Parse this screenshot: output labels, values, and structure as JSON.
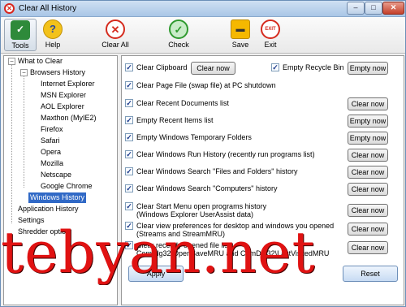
{
  "window": {
    "title": "Clear All History",
    "controls": {
      "minimize": "–",
      "maximize": "□",
      "close": "✕"
    }
  },
  "toolbar": {
    "tools_label": "Tools",
    "help_label": "Help",
    "clear_all_label": "Clear All",
    "check_label": "Check",
    "save_label": "Save",
    "exit_label": "Exit",
    "exit_icon_text": "EXIT"
  },
  "tree": {
    "what_to_clear": "What to Clear",
    "browsers_history": "Browsers History",
    "browsers": [
      "Internet Explorer",
      "MSN Explorer",
      "AOL Explorer",
      "Maxthon (MyIE2)",
      "Firefox",
      "Safari",
      "Opera",
      "Mozilla",
      "Netscape",
      "Google Chrome"
    ],
    "windows_history": "Windows History",
    "application_history": "Application History",
    "settings": "Settings",
    "shredder_option": "Shredder option"
  },
  "panel": {
    "items": [
      {
        "label": "Clear Clipboard",
        "checked": true,
        "button": "Clear now"
      },
      {
        "label": "Empty Recycle Bin",
        "checked": true,
        "button": "Empty now"
      },
      {
        "label": "Clear Page File (swap file) at PC shutdown",
        "checked": true,
        "button": ""
      },
      {
        "label": "Clear Recent Documents list",
        "checked": true,
        "button": "Clear now"
      },
      {
        "label": "Empty Recent Items list",
        "checked": true,
        "button": "Empty now"
      },
      {
        "label": "Empty Windows Temporary Folders",
        "checked": true,
        "button": "Empty now"
      },
      {
        "label": "Clear Windows Run History (recently run programs list)",
        "checked": true,
        "button": "Clear now"
      },
      {
        "label": "Clear Windows Search \"Files and Folders\" history",
        "checked": true,
        "button": "Clear now"
      },
      {
        "label": "Clear Windows Search \"Computers\" history",
        "checked": true,
        "button": "Clear now"
      },
      {
        "label": "Clear Start Menu open programs history",
        "label2": "(Windows Explorer UserAssist data)",
        "checked": true,
        "button": "Clear now"
      },
      {
        "label": "Clear view preferences for desktop and windows you opened",
        "label2": "(Streams and StreamMRU)",
        "checked": true,
        "button": "Clear now"
      },
      {
        "label": "Clear recently opened file list",
        "label2": "ComDlg32\\OpenSaveMRU and ComDlg32\\LastVisitedMRU",
        "checked": true,
        "button": "Clear now"
      }
    ],
    "apply_label": "Apply",
    "reset_label": "Reset"
  },
  "watermark": "tebyan.net"
}
